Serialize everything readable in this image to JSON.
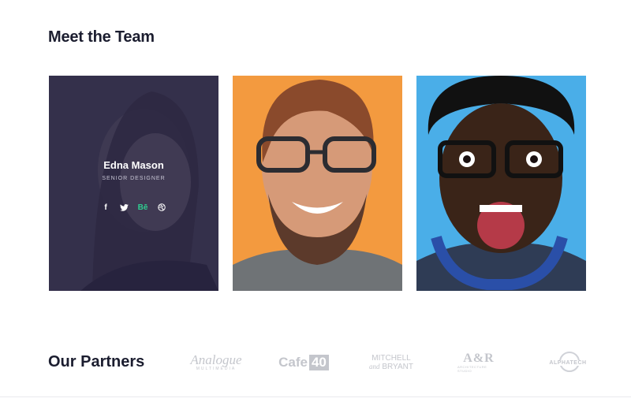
{
  "team": {
    "title": "Meet the Team",
    "members": [
      {
        "name": "Edna Mason",
        "role": "SENIOR DESIGNER",
        "socials": [
          "facebook-icon",
          "twitter-icon",
          "behance-icon",
          "dribbble-icon"
        ]
      },
      {},
      {}
    ]
  },
  "partners": {
    "title": "Our Partners",
    "logos": {
      "analogue_main": "Analogue",
      "analogue_sub": "MULTIMEDIA",
      "cafe_word": "Cafe",
      "cafe_num": "40",
      "mitchell_top": "MITCHELL",
      "mitchell_and": "and",
      "mitchell_bottom": "BRYANT",
      "aor_main": "A&R",
      "aor_sub": "ARCHITECTURE STUDIO",
      "alpha": "ALPHATECH"
    }
  },
  "colors": {
    "heading": "#1b1d2f",
    "overlay": "#262240",
    "accent_green": "#2ecc8f",
    "partner_gray": "#c4c6cc",
    "card2_bg": "#f39a3f",
    "card3_bg": "#4aaee8"
  }
}
